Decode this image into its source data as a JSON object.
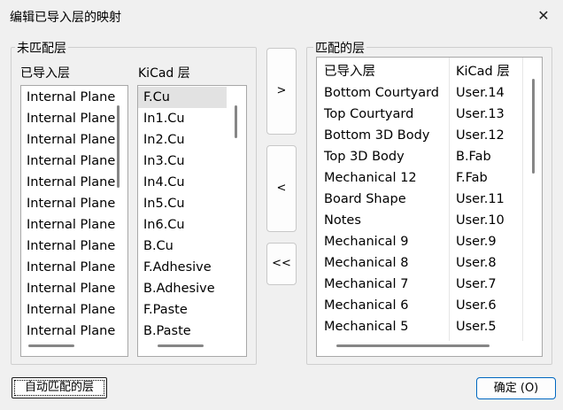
{
  "window": {
    "title": "编辑已导入层的映射",
    "close_glyph": "✕"
  },
  "unmatched": {
    "group_label": "未匹配层",
    "imported_header": "已导入层",
    "kicad_header": "KiCad 层",
    "imported_items": [
      "Internal Plane",
      "Internal Plane",
      "Internal Plane",
      "Internal Plane",
      "Internal Plane",
      "Internal Plane",
      "Internal Plane",
      "Internal Plane",
      "Internal Plane",
      "Internal Plane",
      "Internal Plane",
      "Internal Plane"
    ],
    "kicad_items": [
      "F.Cu",
      "In1.Cu",
      "In2.Cu",
      "In3.Cu",
      "In4.Cu",
      "In5.Cu",
      "In6.Cu",
      "B.Cu",
      "F.Adhesive",
      "B.Adhesive",
      "F.Paste",
      "B.Paste"
    ],
    "kicad_selected_index": 0
  },
  "buttons": {
    "add": ">",
    "remove": "<",
    "remove_all": "<<",
    "auto_match": "自动匹配的层",
    "ok": "确定 (O)"
  },
  "matched": {
    "group_label": "匹配的层",
    "columns": [
      "已导入层",
      "KiCad 层"
    ],
    "rows": [
      [
        "Bottom Courtyard",
        "User.14"
      ],
      [
        "Top Courtyard",
        "User.13"
      ],
      [
        "Bottom 3D Body",
        "User.12"
      ],
      [
        "Top 3D Body",
        "B.Fab"
      ],
      [
        "Mechanical 12",
        "F.Fab"
      ],
      [
        "Board Shape",
        "User.11"
      ],
      [
        "Notes",
        "User.10"
      ],
      [
        "Mechanical 9",
        "User.9"
      ],
      [
        "Mechanical 8",
        "User.8"
      ],
      [
        "Mechanical 7",
        "User.7"
      ],
      [
        "Mechanical 6",
        "User.6"
      ],
      [
        "Mechanical 5",
        "User.5"
      ]
    ]
  }
}
